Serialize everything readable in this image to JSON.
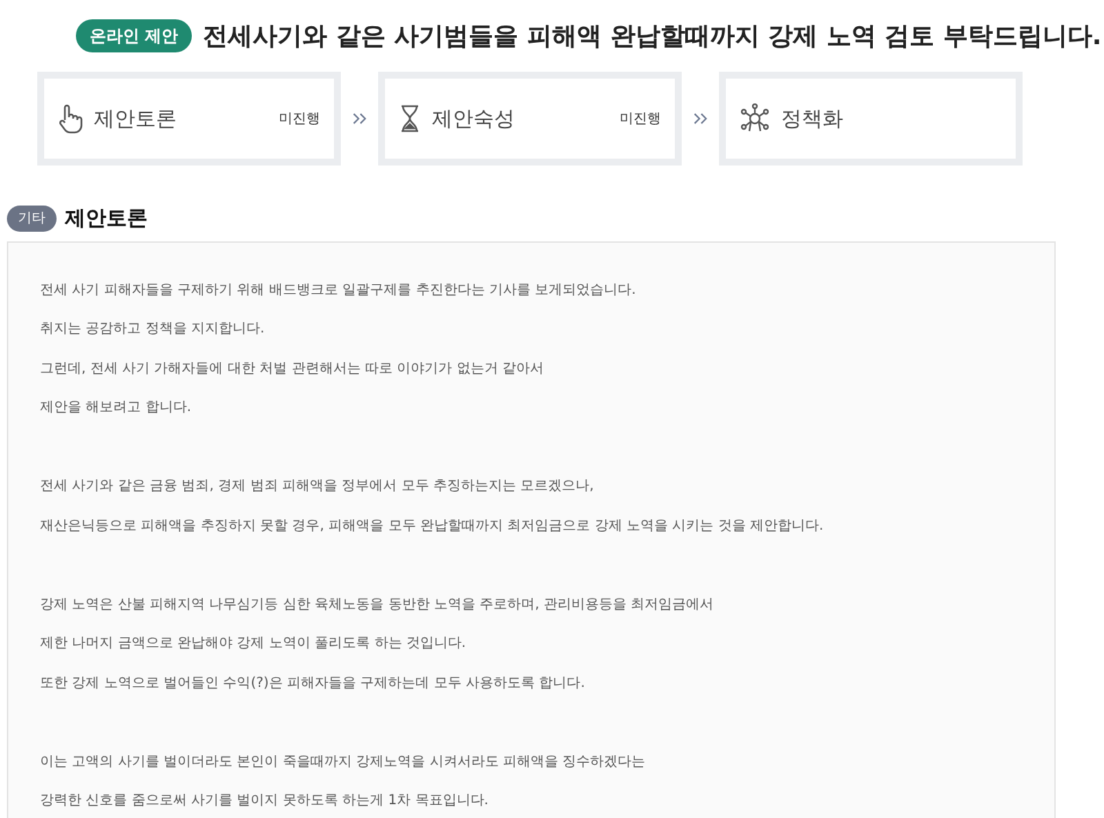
{
  "header": {
    "badge": "온라인 제안",
    "title": "전세사기와 같은 사기범들을 피해액 완납할때까지 강제 노역 검토 부탁드립니다."
  },
  "steps": [
    {
      "kind": "hand",
      "label": "제안토론",
      "status": "미진행"
    },
    {
      "kind": "hourglass",
      "label": "제안숙성",
      "status": "미진행"
    },
    {
      "kind": "network",
      "label": "정책화"
    }
  ],
  "section": {
    "category": "기타",
    "title": "제안토론"
  },
  "body": [
    [
      "전세 사기 피해자들을 구제하기 위해 배드뱅크로 일괄구제를 추진한다는 기사를 보게되었습니다.",
      "취지는 공감하고 정책을 지지합니다.",
      "그런데, 전세 사기 가해자들에 대한 처벌 관련해서는 따로 이야기가 없는거 같아서",
      "제안을 해보려고 합니다."
    ],
    [
      "전세 사기와 같은 금융 범죄, 경제 범죄 피해액을 정부에서 모두 추징하는지는 모르겠으나,",
      "재산은닉등으로 피해액을 추징하지 못할 경우, 피해액을 모두 완납할때까지 최저임금으로 강제 노역을 시키는 것을 제안합니다."
    ],
    [
      "강제 노역은 산불 피해지역 나무심기등 심한 육체노동을 동반한 노역을 주로하며, 관리비용등을 최저임금에서",
      "제한 나머지 금액으로 완납해야 강제 노역이 풀리도록 하는 것입니다.",
      "또한 강제 노역으로 벌어들인 수익(?)은 피해자들을 구제하는데 모두 사용하도록 합니다."
    ],
    [
      "이는 고액의 사기를 벌이더라도 본인이 죽을때까지 강제노역을 시켜서라도 피해액을 징수하겠다는",
      "강력한 신호를 줌으로써 사기를 벌이지 못하도록 하는게 1차 목표입니다."
    ]
  ]
}
